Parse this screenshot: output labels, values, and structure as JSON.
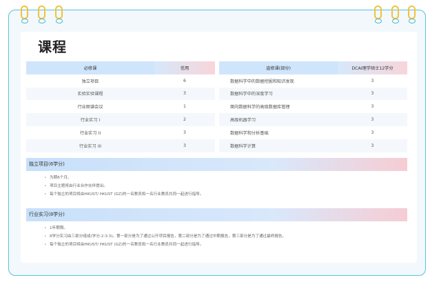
{
  "page": {
    "title": "课程"
  },
  "required_table": {
    "headers": [
      "必修课",
      "信用"
    ],
    "rows": [
      [
        "独立项目",
        "6"
      ],
      [
        "实验实验课程",
        "3"
      ],
      [
        "行业图谱会议",
        "1"
      ],
      [
        "行业实习 I",
        "2"
      ],
      [
        "行业实习 II",
        "3"
      ],
      [
        "行业实习 III",
        "3"
      ]
    ]
  },
  "elective_table": {
    "headers": [
      "选修课(部分)",
      "DCAI理学硕士12学分"
    ],
    "rows": [
      [
        "数据科学中的数据挖掘和知识发现",
        "3"
      ],
      [
        "数据科学中的深度学习",
        "3"
      ],
      [
        "面向数据科学的高级数据库管理",
        "3"
      ],
      [
        "高级机器学习",
        "3"
      ],
      [
        "数据科学和分析基础",
        "3"
      ],
      [
        "数据科学计算",
        "3"
      ]
    ]
  },
  "sections": [
    {
      "title": "独立项目(6学分)",
      "bullets": [
        "为期6个月。",
        "项目主题将由行业合作伙伴提出。",
        "每个独立的项目将由HKUST/ HKUST (GZ)的一名教员和一名行业教员共同一起进行指导。"
      ]
    },
    {
      "title": "行业实习(8学分)",
      "bullets": [
        "1年期限。",
        "8学分实习由三部分组成(学分:2:3:3)。第一部分是为了通过公开项目报告，第二部分是为了通过中期报告，第三部分是为了通过最终报告。",
        "每个独立的项目将由HKUST/ HKUST (GZ)的一名教员和一名行业教员共同一起进行指导。"
      ]
    }
  ],
  "colors": {
    "frame": "#52c3d6",
    "ring": "#f3c13a",
    "header_blue": "#cfe5fb",
    "header_pink": "#f8d5da"
  }
}
